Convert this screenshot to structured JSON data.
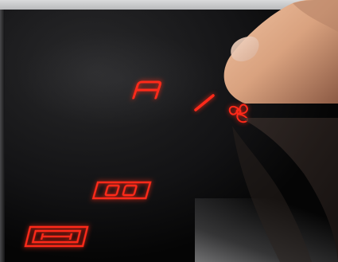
{
  "scene": {
    "description_colors": {
      "glass": "#050505",
      "led": "#ff2a1a",
      "skin": "#d9a27f",
      "frame": "#c9c9cb"
    }
  },
  "icons": {
    "auto_icon": "letter-a-icon",
    "separator": "slash-icon",
    "fan_icon": "fan-icon",
    "timer_icon": "double-zero-display-icon",
    "size_icon": "zone-size-icon"
  }
}
